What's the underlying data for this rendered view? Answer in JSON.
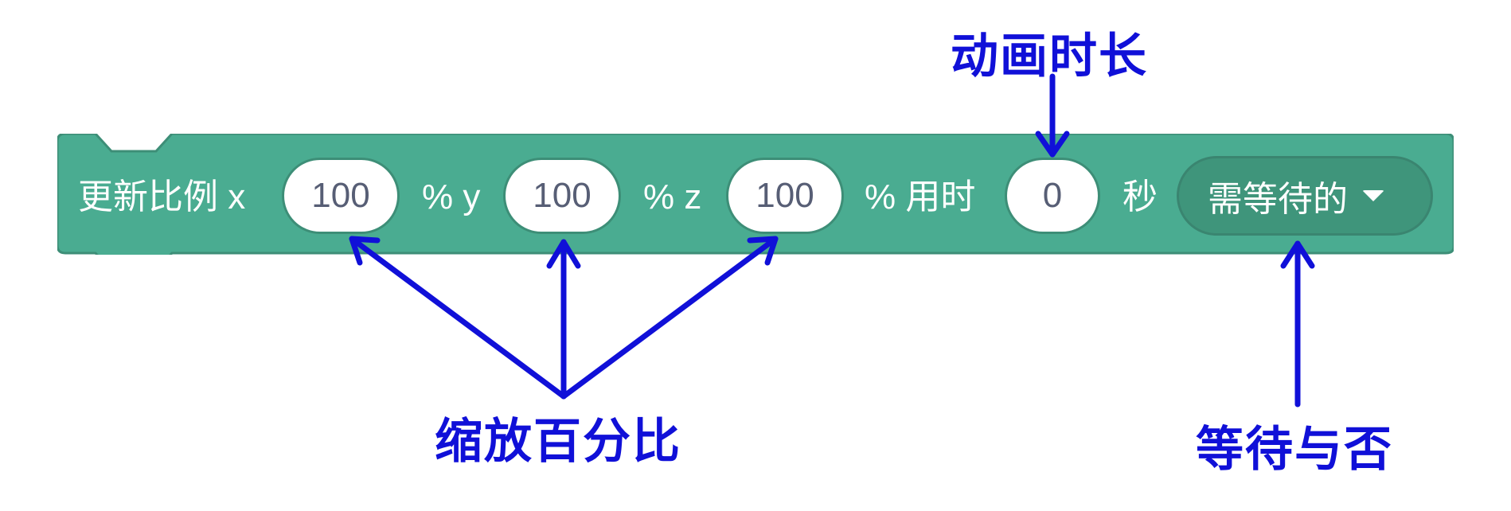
{
  "block": {
    "color": "#4aac91",
    "label": "更新比例 x",
    "x_value": "100",
    "sep_y": "% y",
    "y_value": "100",
    "sep_z": "% z",
    "z_value": "100",
    "sep_time": "% 用时",
    "time_value": "0",
    "unit_seconds": "秒",
    "wait_option": "需等待的"
  },
  "annotations": {
    "duration": "动画时长",
    "scale_percent": "缩放百分比",
    "wait_or_not": "等待与否",
    "color": "#1010d8"
  }
}
